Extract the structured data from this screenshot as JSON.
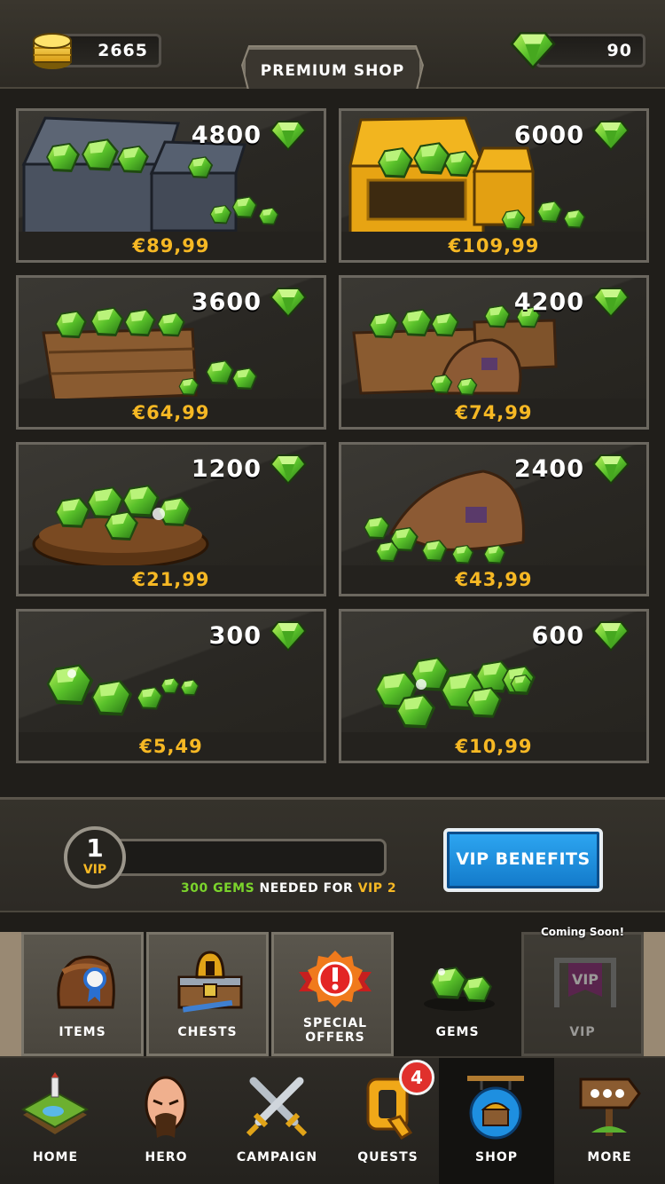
{
  "header": {
    "title": "PREMIUM SHOP",
    "gold": "2665",
    "gems": "90"
  },
  "offers": [
    {
      "amount": "4800",
      "price": "€89,99",
      "art": "iron-chests-icon"
    },
    {
      "amount": "6000",
      "price": "€109,99",
      "art": "gold-chests-icon"
    },
    {
      "amount": "3600",
      "price": "€64,99",
      "art": "crate-icon"
    },
    {
      "amount": "4200",
      "price": "€74,99",
      "art": "crates-and-sack-icon"
    },
    {
      "amount": "1200",
      "price": "€21,99",
      "art": "bowl-icon"
    },
    {
      "amount": "2400",
      "price": "€43,99",
      "art": "sack-icon"
    },
    {
      "amount": "300",
      "price": "€5,49",
      "art": "few-gems-icon"
    },
    {
      "amount": "600",
      "price": "€10,99",
      "art": "gem-pile-icon"
    }
  ],
  "vip": {
    "level": "1",
    "label": "VIP",
    "progress": 0,
    "need_amount": "300 GEMS",
    "need_text": " NEEDED FOR ",
    "need_target": "VIP 2",
    "button": "VIP BENEFITS"
  },
  "categories": [
    {
      "label": "ITEMS",
      "state": "normal"
    },
    {
      "label": "CHESTS",
      "state": "normal"
    },
    {
      "label": "SPECIAL OFFERS",
      "state": "normal"
    },
    {
      "label": "GEMS",
      "state": "active"
    },
    {
      "label": "VIP",
      "state": "disabled",
      "note": "Coming Soon!"
    }
  ],
  "nav": [
    {
      "label": "HOME"
    },
    {
      "label": "HERO"
    },
    {
      "label": "CAMPAIGN"
    },
    {
      "label": "QUESTS",
      "badge": "4"
    },
    {
      "label": "SHOP",
      "active": true
    },
    {
      "label": "MORE"
    }
  ],
  "colors": {
    "price": "#f6b824",
    "gem": "#5fc72a",
    "vip_button": "#1e8fe0",
    "badge": "#e0302c"
  }
}
